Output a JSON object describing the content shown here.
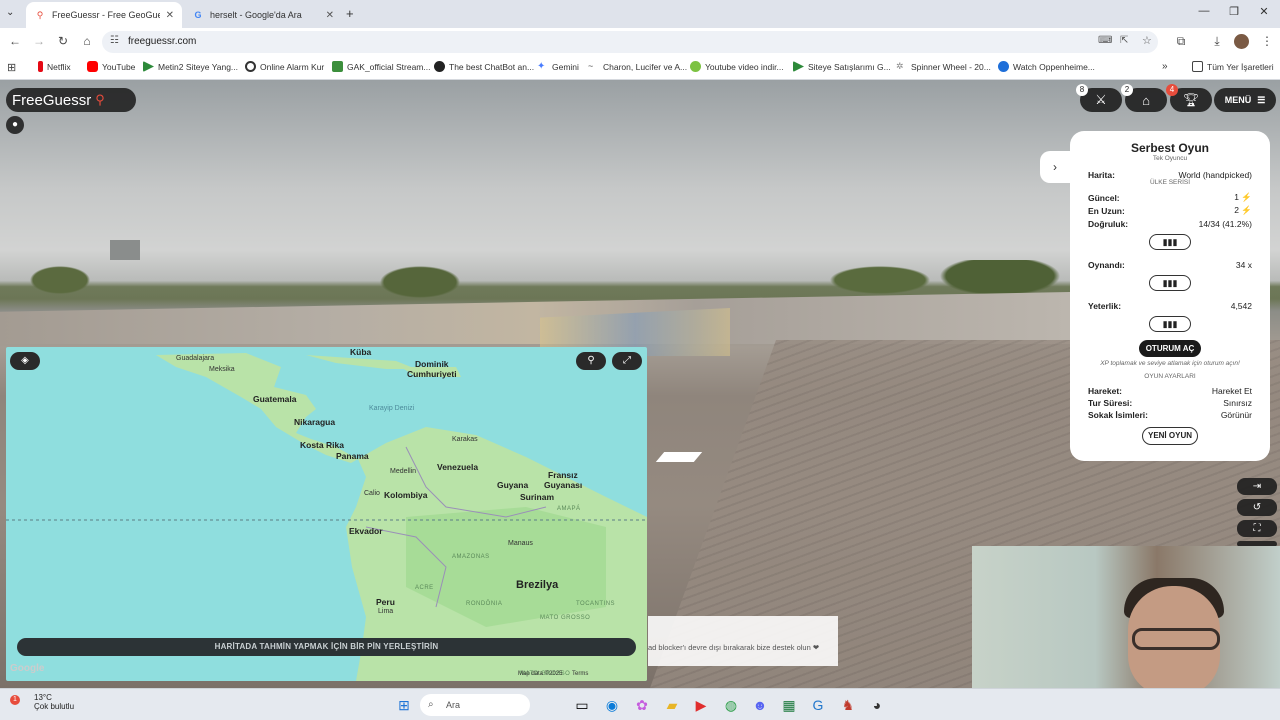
{
  "browser": {
    "tabs": [
      {
        "title": "FreeGuessr - Free GeoGuessr Al",
        "active": true
      },
      {
        "title": "herselt - Google'da Ara",
        "active": false
      }
    ],
    "url": "freeguessr.com",
    "bookmarks": [
      "Netflix",
      "YouTube",
      "Metin2 Siteye Yang...",
      "Online Alarm Kur",
      "GAK_official Stream...",
      "The best ChatBot an...",
      "Gemini",
      "Charon, Lucifer ve A...",
      "Youtube video indir...",
      "Siteye Satışlarımı G...",
      "Spinner Wheel - 20...",
      "Watch Oppenheime..."
    ],
    "all_bookmarks": "Tüm Yer İşaretleri",
    "more_bookmarks": "»"
  },
  "game": {
    "logo": "FreeGuessr",
    "badges": {
      "battle": "8",
      "shop": "2",
      "trophy": "4"
    },
    "menu_label": "MENÜ",
    "panel": {
      "title": "Serbest Oyun",
      "subtitle": "Tek Oyuncu",
      "map_label": "Harita:",
      "map_value": "World (handpicked)",
      "series_header": "ÜLKE SERİSİ",
      "current_label": "Güncel:",
      "current_value": "1",
      "longest_label": "En Uzun:",
      "longest_value": "2",
      "accuracy_label": "Doğruluk:",
      "accuracy_value": "14/34 (41.2%)",
      "played_label": "Oynandı:",
      "played_value": "34 x",
      "skill_label": "Yeterlik:",
      "skill_value": "4,542",
      "login_button": "OTURUM AÇ",
      "login_note": "XP toplamak ve seviye atlamak için oturum açın!",
      "settings_header": "OYUN AYARLARI",
      "move_label": "Hareket:",
      "move_value": "Hareket Et",
      "time_label": "Tur Süresi:",
      "time_value": "Sınırsız",
      "streets_label": "Sokak İsimleri:",
      "streets_value": "Görünür",
      "new_game_button": "YENİ OYUN"
    },
    "map": {
      "hint": "HARİTADA TAHMİN YAPMAK İÇİN BİR PİN YERLEŞTİRİN",
      "google": "Google",
      "keyboard_shortcuts": "Klavye kısayolları",
      "map_data": "Map data ©2025",
      "terms": "Terms",
      "labels": {
        "kuba": "Küba",
        "dominik": "Dominik",
        "cumhuriyeti": "Cumhuriyeti",
        "guadalajara": "Guadalajara",
        "meksika": "Meksika",
        "guatemala": "Guatemala",
        "nikaragua": "Nikaragua",
        "karayip": "Karayip Denizi",
        "kosta": "Kosta Rika",
        "panama": "Panama",
        "karakas": "Karakas",
        "venezuela": "Venezuela",
        "medellin": "Medellin",
        "kolombiya": "Kolombiya",
        "cali": "Calio",
        "guyana": "Guyana",
        "surinam": "Surinam",
        "fransiz": "Fransız",
        "guyanasi": "Guyanası",
        "ekvador": "Ekvador",
        "manaus": "Manaus",
        "amazonas": "AMAZONAS",
        "amapa": "AMAPÁ",
        "brezilya": "Brezilya",
        "peru": "Peru",
        "lima": "Lima",
        "acre": "ACRE",
        "rondonia": "RONDÔNIA",
        "tocantins": "TOCANTINS",
        "mato": "MATO GROSSO",
        "matos": "MATO GROSSO"
      }
    },
    "adblock": "ad blocker'ı devre dışı bırakarak bize destek olun ❤"
  },
  "taskbar": {
    "temp": "13°C",
    "weather": "Çok bulutlu",
    "search": "Ara",
    "weather_badge": "1"
  },
  "colors": {
    "accent_red": "#e74c3c",
    "dark_ui": "#1e1e1e",
    "sea": "#8fdede",
    "land": "#b9e3a8"
  }
}
